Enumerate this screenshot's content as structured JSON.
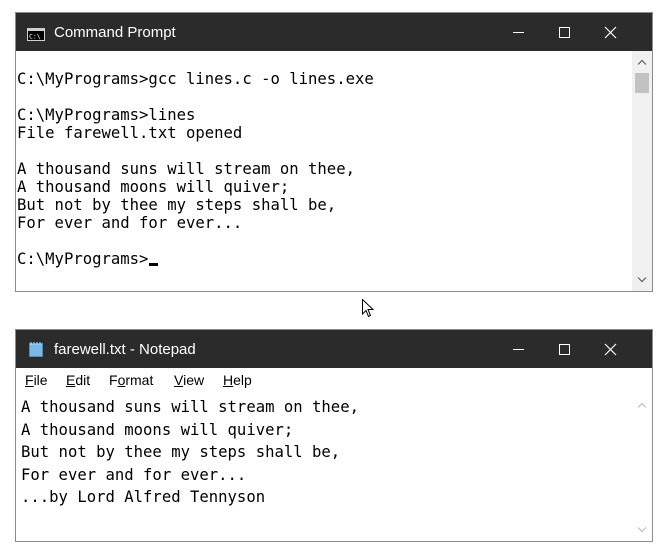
{
  "cmd": {
    "title": "Command Prompt",
    "icon": "console-icon",
    "lines": [
      "C:\\MyPrograms>gcc lines.c -o lines.exe",
      "",
      "C:\\MyPrograms>lines",
      "File farewell.txt opened",
      "",
      "A thousand suns will stream on thee,",
      "A thousand moons will quiver;",
      "But not by thee my steps shall be,",
      "For ever and for ever...",
      "",
      "C:\\MyPrograms>"
    ]
  },
  "notepad": {
    "title": "farewell.txt - Notepad",
    "icon": "notepad-icon",
    "menu": [
      {
        "label": "File",
        "accel": "F",
        "rest": "ile"
      },
      {
        "label": "Edit",
        "accel": "E",
        "rest": "dit"
      },
      {
        "label": "Format",
        "accel": "o",
        "pre": "F",
        "rest": "rmat"
      },
      {
        "label": "View",
        "accel": "V",
        "rest": "iew"
      },
      {
        "label": "Help",
        "accel": "H",
        "rest": "elp"
      }
    ],
    "lines": [
      "A thousand suns will stream on thee,",
      "A thousand moons will quiver;",
      "But not by thee my steps shall be,",
      "For ever and for ever...",
      "...by Lord Alfred Tennyson"
    ]
  },
  "colors": {
    "titlebar": "#2b2b2b",
    "title_text": "#ffffff",
    "scrollbar_track": "#f0f0f0",
    "scrollbar_thumb": "#c2c2c2"
  }
}
